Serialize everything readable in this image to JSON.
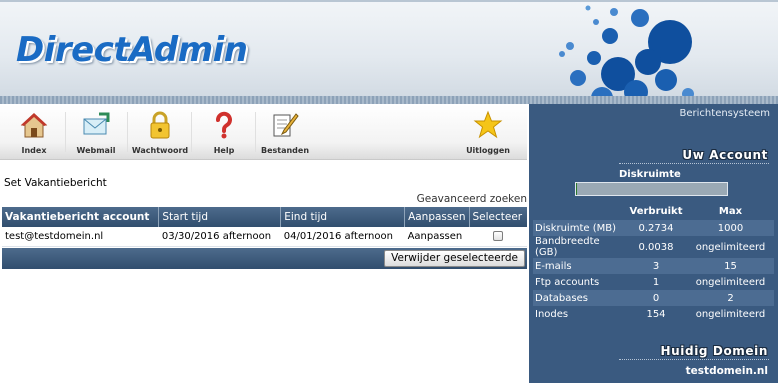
{
  "header": {
    "logo": "DirectAdmin"
  },
  "toolbar": {
    "items": [
      {
        "label": "Index",
        "icon": "house-icon"
      },
      {
        "label": "Webmail",
        "icon": "envelope-icon"
      },
      {
        "label": "Wachtwoord",
        "icon": "padlock-icon"
      },
      {
        "label": "Help",
        "icon": "question-mark-icon"
      },
      {
        "label": "Bestanden",
        "icon": "files-icon"
      },
      {
        "label": "Uitloggen",
        "icon": "star-icon"
      }
    ]
  },
  "main": {
    "title": "Set Vakantiebericht",
    "advanced_search": "Geavanceerd zoeken",
    "table": {
      "columns": [
        "Vakantiebericht account",
        "Start tijd",
        "Eind tijd",
        "Aanpassen",
        "Selecteer"
      ],
      "rows": [
        {
          "account": "test@testdomein.nl",
          "start": "03/30/2016 afternoon",
          "end": "04/01/2016 afternoon",
          "edit": "Aanpassen"
        }
      ]
    },
    "delete_button": "Verwijder geselecteerde"
  },
  "sidebar": {
    "messages_link": "Berichtensysteem",
    "account_title": "Uw Account",
    "disk_label": "Diskruimte",
    "disk_usage_fraction": 0.0003,
    "stats_headers": [
      "Verbruikt",
      "Max"
    ],
    "stats": [
      {
        "name": "Diskruimte (MB)",
        "used": "0.2734",
        "max": "1000"
      },
      {
        "name": "Bandbreedte (GB)",
        "used": "0.0038",
        "max": "ongelimiteerd"
      },
      {
        "name": "E-mails",
        "used": "3",
        "max": "15"
      },
      {
        "name": "Ftp accounts",
        "used": "1",
        "max": "ongelimiteerd"
      },
      {
        "name": "Databases",
        "used": "0",
        "max": "2"
      },
      {
        "name": "Inodes",
        "used": "154",
        "max": "ongelimiteerd"
      }
    ],
    "domain_title": "Huidig Domein",
    "domain": "testdomein.nl"
  },
  "colors": {
    "header_blue": "#1a6bc4",
    "sidebar": "#3a5a80",
    "table_header": "#3d5b7d"
  }
}
